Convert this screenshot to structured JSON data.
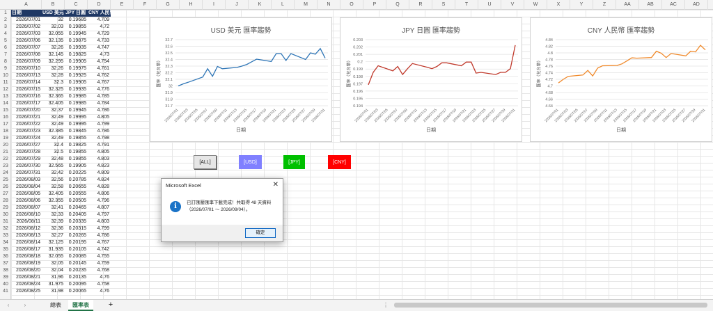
{
  "columns": [
    "A",
    "B",
    "C",
    "D",
    "E",
    "F",
    "G",
    "H",
    "I",
    "J",
    "K",
    "L",
    "M",
    "N",
    "O",
    "P",
    "Q",
    "R",
    "S",
    "T",
    "U",
    "V",
    "W",
    "X",
    "Y",
    "Z",
    "AA",
    "AB",
    "AC",
    "AD"
  ],
  "headers": [
    "日期",
    "USD 美元",
    "JPY 日圓",
    "CNY 人民幣"
  ],
  "rows": [
    [
      "2026/07/01",
      "32",
      "0.19685",
      "4.709"
    ],
    [
      "2026/07/02",
      "32.03",
      "0.19855",
      "4.72"
    ],
    [
      "2026/07/03",
      "32.055",
      "0.19945",
      "4.729"
    ],
    [
      "2026/07/06",
      "32.135",
      "0.19875",
      "4.733"
    ],
    [
      "2026/07/07",
      "32.26",
      "0.19935",
      "4.747"
    ],
    [
      "2026/07/08",
      "32.145",
      "0.19825",
      "4.73"
    ],
    [
      "2026/07/09",
      "32.295",
      "0.19905",
      "4.754"
    ],
    [
      "2026/07/10",
      "32.26",
      "0.19975",
      "4.761"
    ],
    [
      "2026/07/13",
      "32.28",
      "0.19925",
      "4.762"
    ],
    [
      "2026/07/14",
      "32.3",
      "0.19905",
      "4.767"
    ],
    [
      "2026/07/15",
      "32.325",
      "0.19935",
      "4.776"
    ],
    [
      "2026/07/16",
      "32.365",
      "0.19985",
      "4.785"
    ],
    [
      "2026/07/17",
      "32.405",
      "0.19985",
      "4.784"
    ],
    [
      "2026/07/20",
      "32.37",
      "0.19945",
      "4.786"
    ],
    [
      "2026/07/21",
      "32.49",
      "0.19995",
      "4.805"
    ],
    [
      "2026/07/22",
      "32.49",
      "0.19995",
      "4.799"
    ],
    [
      "2026/07/23",
      "32.385",
      "0.19845",
      "4.786"
    ],
    [
      "2026/07/24",
      "32.49",
      "0.19855",
      "4.798"
    ],
    [
      "2026/07/27",
      "32.4",
      "0.19825",
      "4.791"
    ],
    [
      "2026/07/28",
      "32.5",
      "0.19855",
      "4.805"
    ],
    [
      "2026/07/29",
      "32.48",
      "0.19855",
      "4.803"
    ],
    [
      "2026/07/30",
      "32.565",
      "0.19905",
      "4.823"
    ],
    [
      "2026/07/31",
      "32.42",
      "0.20225",
      "4.809"
    ],
    [
      "2026/08/03",
      "32.56",
      "0.20785",
      "4.824"
    ],
    [
      "2026/08/04",
      "32.58",
      "0.20655",
      "4.828"
    ],
    [
      "2026/08/05",
      "32.405",
      "0.20555",
      "4.806"
    ],
    [
      "2026/08/06",
      "32.355",
      "0.20505",
      "4.796"
    ],
    [
      "2026/08/07",
      "32.41",
      "0.20465",
      "4.807"
    ],
    [
      "2026/08/10",
      "32.33",
      "0.20405",
      "4.797"
    ],
    [
      "2026/08/11",
      "32.39",
      "0.20335",
      "4.803"
    ],
    [
      "2026/08/12",
      "32.36",
      "0.20315",
      "4.799"
    ],
    [
      "2026/08/13",
      "32.27",
      "0.20265",
      "4.786"
    ],
    [
      "2026/08/14",
      "32.125",
      "0.20195",
      "4.767"
    ],
    [
      "2026/08/17",
      "31.935",
      "0.20105",
      "4.742"
    ],
    [
      "2026/08/18",
      "32.055",
      "0.20085",
      "4.755"
    ],
    [
      "2026/08/19",
      "32.05",
      "0.20145",
      "4.759"
    ],
    [
      "2026/08/20",
      "32.04",
      "0.20235",
      "4.768"
    ],
    [
      "2026/08/21",
      "31.96",
      "0.20135",
      "4.76"
    ],
    [
      "2026/08/24",
      "31.975",
      "0.20095",
      "4.758"
    ],
    [
      "2026/08/25",
      "31.98",
      "0.20065",
      "4.76"
    ]
  ],
  "chart_data": [
    {
      "type": "line",
      "title": "USD 美元 匯率趨勢",
      "xlabel": "日期",
      "ylabel": "匯率（兌台幣）",
      "color": "#2e75b6",
      "ylim": [
        31.7,
        32.7
      ],
      "yticks": [
        "32.7",
        "32.6",
        "32.5",
        "32.4",
        "32.3",
        "32.2",
        "32.1",
        "32",
        "31.9",
        "31.8",
        "31.7"
      ],
      "x": [
        "2026/07/01",
        "2026/07/02",
        "2026/07/03",
        "2026/07/06",
        "2026/07/07",
        "2026/07/08",
        "2026/07/09",
        "2026/07/10",
        "2026/07/13",
        "2026/07/14",
        "2026/07/15",
        "2026/07/16",
        "2026/07/17",
        "2026/07/20",
        "2026/07/21",
        "2026/07/22",
        "2026/07/23",
        "2026/07/24",
        "2026/07/27",
        "2026/07/28",
        "2026/07/29",
        "2026/07/30",
        "2026/07/31"
      ],
      "xticks": [
        "2026/07/01",
        "2026/07/03",
        "2026/07/05",
        "2026/07/07",
        "2026/07/09",
        "2026/07/11",
        "2026/07/13",
        "2026/07/15",
        "2026/07/17",
        "2026/07/19",
        "2026/07/21",
        "2026/07/23",
        "2026/07/25",
        "2026/07/27",
        "2026/07/29",
        "2026/07/31"
      ],
      "values": [
        32,
        32.03,
        32.055,
        32.135,
        32.26,
        32.145,
        32.295,
        32.26,
        32.28,
        32.3,
        32.325,
        32.365,
        32.405,
        32.37,
        32.49,
        32.49,
        32.385,
        32.49,
        32.4,
        32.5,
        32.48,
        32.565,
        32.42
      ]
    },
    {
      "type": "line",
      "title": "JPY 日圓 匯率趨勢",
      "xlabel": "日期",
      "ylabel": "匯率（兌台幣）",
      "color": "#c0392b",
      "ylim": [
        0.194,
        0.203
      ],
      "yticks": [
        "0.203",
        "0.202",
        "0.201",
        "0.2",
        "0.199",
        "0.198",
        "0.197",
        "0.196",
        "0.195",
        "0.194"
      ],
      "x": [
        "2026/07/01",
        "2026/07/02",
        "2026/07/03",
        "2026/07/06",
        "2026/07/07",
        "2026/07/08",
        "2026/07/09",
        "2026/07/10",
        "2026/07/13",
        "2026/07/14",
        "2026/07/15",
        "2026/07/16",
        "2026/07/17",
        "2026/07/20",
        "2026/07/21",
        "2026/07/22",
        "2026/07/23",
        "2026/07/24",
        "2026/07/27",
        "2026/07/28",
        "2026/07/29",
        "2026/07/30",
        "2026/07/31"
      ],
      "xticks": [
        "2026/07/01",
        "2026/07/03",
        "2026/07/05",
        "2026/07/07",
        "2026/07/09",
        "2026/07/11",
        "2026/07/13",
        "2026/07/15",
        "2026/07/17",
        "2026/07/19",
        "2026/07/21",
        "2026/07/23",
        "2026/07/25",
        "2026/07/27",
        "2026/07/29",
        "2026/07/31"
      ],
      "values": [
        0.19685,
        0.19855,
        0.19945,
        0.19875,
        0.19935,
        0.19825,
        0.19905,
        0.19975,
        0.19925,
        0.19905,
        0.19935,
        0.19985,
        0.19985,
        0.19945,
        0.19995,
        0.19995,
        0.19845,
        0.19855,
        0.19825,
        0.19855,
        0.19855,
        0.19905,
        0.20225
      ]
    },
    {
      "type": "line",
      "title": "CNY 人民幣 匯率趨勢",
      "xlabel": "日期",
      "ylabel": "匯率（兌台幣）",
      "color": "#f0892a",
      "ylim": [
        4.64,
        4.84
      ],
      "yticks": [
        "4.84",
        "4.82",
        "4.8",
        "4.78",
        "4.76",
        "4.74",
        "4.72",
        "4.7",
        "4.68",
        "4.66",
        "4.64"
      ],
      "x": [
        "2026/07/01",
        "2026/07/02",
        "2026/07/03",
        "2026/07/06",
        "2026/07/07",
        "2026/07/08",
        "2026/07/09",
        "2026/07/10",
        "2026/07/13",
        "2026/07/14",
        "2026/07/15",
        "2026/07/16",
        "2026/07/17",
        "2026/07/20",
        "2026/07/21",
        "2026/07/22",
        "2026/07/23",
        "2026/07/24",
        "2026/07/27",
        "2026/07/28",
        "2026/07/29",
        "2026/07/30",
        "2026/07/31"
      ],
      "xticks": [
        "2026/07/01",
        "2026/07/03",
        "2026/07/05",
        "2026/07/07",
        "2026/07/09",
        "2026/07/11",
        "2026/07/13",
        "2026/07/15",
        "2026/07/17",
        "2026/07/19",
        "2026/07/21",
        "2026/07/23",
        "2026/07/25",
        "2026/07/27",
        "2026/07/29",
        "2026/07/31"
      ],
      "values": [
        4.709,
        4.72,
        4.729,
        4.733,
        4.747,
        4.73,
        4.754,
        4.761,
        4.762,
        4.767,
        4.776,
        4.785,
        4.784,
        4.786,
        4.805,
        4.799,
        4.786,
        4.798,
        4.791,
        4.805,
        4.803,
        4.823,
        4.809
      ]
    }
  ],
  "buttons": [
    {
      "label": "[ALL]",
      "bg": "#e6e6e6",
      "fg": "#222"
    },
    {
      "label": "[USD]",
      "bg": "#8080ff",
      "fg": "#ffffff"
    },
    {
      "label": "[JPY]",
      "bg": "#00c000",
      "fg": "#ffffff"
    },
    {
      "label": "[CNY]",
      "bg": "#ff0000",
      "fg": "#ffffff"
    }
  ],
  "dialog": {
    "title": "Microsoft Excel",
    "close": "✕",
    "icon": "info-icon",
    "message": "已訂匯壓匯率下載完成！共取得 48 天資料（2026/07/01 ～ 2026/09/04）。",
    "ok": "確定"
  },
  "sheet_tabs": {
    "sheet1": "總表",
    "sheet2": "匯率表",
    "add": "+",
    "prev": "‹",
    "next": "›",
    "menu": "⋮"
  }
}
